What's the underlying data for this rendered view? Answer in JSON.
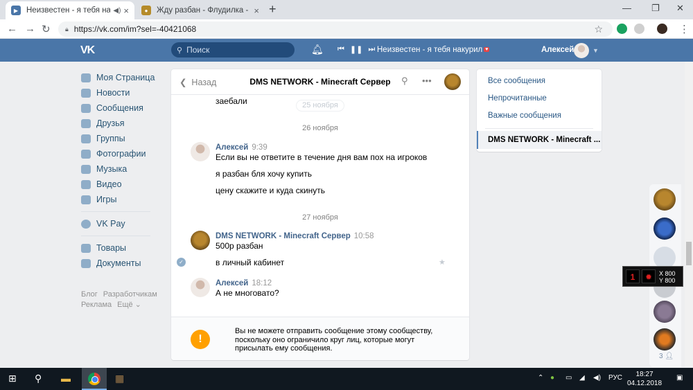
{
  "browser": {
    "tabs": [
      {
        "title": "Неизвестен - я тебя накури",
        "active": true
      },
      {
        "title": "Жду разбан - Флудилка - DMS N",
        "active": false
      }
    ],
    "url": "https://vk.com/im?sel=-40421068"
  },
  "header": {
    "search_placeholder": "Поиск",
    "track": "Неизвестен - я тебя накурил",
    "track_badge": "♥",
    "user_name": "Алексей"
  },
  "menu": {
    "items": [
      "Моя Страница",
      "Новости",
      "Сообщения",
      "Друзья",
      "Группы",
      "Фотографии",
      "Музыка",
      "Видео",
      "Игры"
    ],
    "pay": "VK Pay",
    "extra": [
      "Товары",
      "Документы"
    ],
    "footer": [
      "Блог",
      "Разработчикам",
      "Реклама",
      "Ещё ⌄"
    ]
  },
  "chat": {
    "back": "Назад",
    "title": "DMS NETWORK - Minecraft Сервер",
    "top_line": "заебали",
    "date_pill": "25 ноября",
    "date1": "26 ноября",
    "msg1": {
      "author": "Алексей",
      "time": "9:39",
      "lines": [
        "Если вы не ответите в течение дня вам пох на игроков",
        "я разбан бля хочу купить",
        "цену скажите и куда скинуть"
      ]
    },
    "date2": "27 ноября",
    "msg2": {
      "author": "DMS NETWORK - Minecraft Сервер",
      "time": "10:58",
      "lines": [
        "500р разбан",
        "в личный кабинет"
      ]
    },
    "msg3": {
      "author": "Алексей",
      "time": "18:12",
      "lines": [
        "А не многовато?"
      ]
    },
    "notice": "Вы не можете отправить сообщение этому сообществу, поскольку оно ограничило круг лиц, которые могут присылать ему сообщения."
  },
  "folders": {
    "items": [
      "Все сообщения",
      "Непрочитанные",
      "Важные сообщения"
    ],
    "active": "DMS NETWORK - Minecraft ..."
  },
  "chatbar": {
    "count": "3"
  },
  "overlay": {
    "num": "1",
    "x": "X 800",
    "y": "Y 800"
  },
  "taskbar": {
    "lang": "РУС",
    "time": "18:27",
    "date": "04.12.2018"
  },
  "colors": {
    "vk_blue": "#4a76a8",
    "link": "#2a5885",
    "warn": "#ffa000"
  }
}
